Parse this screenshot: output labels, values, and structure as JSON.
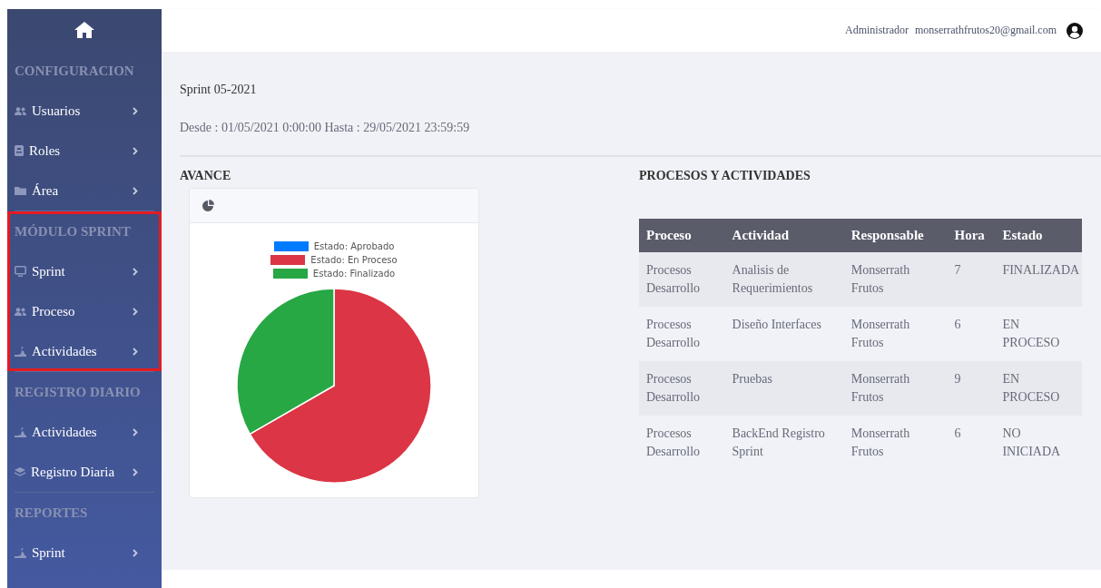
{
  "topbar": {
    "role": "Administrador",
    "email": "monserrathfrutos20@gmail.com"
  },
  "sidebar": {
    "sections": [
      {
        "title": "CONFIGURACION",
        "highlighted": false,
        "items": [
          {
            "label": "Usuarios"
          },
          {
            "label": "Roles"
          },
          {
            "label": "Área"
          }
        ]
      },
      {
        "title": "MÓDULO SPRINT",
        "highlighted": true,
        "items": [
          {
            "label": "Sprint"
          },
          {
            "label": "Proceso"
          },
          {
            "label": "Actividades"
          }
        ]
      },
      {
        "title": "REGISTRO DIARIO",
        "highlighted": false,
        "items": [
          {
            "label": "Actividades"
          },
          {
            "label": "Registro Diaria"
          }
        ]
      },
      {
        "title": "REPORTES",
        "highlighted": false,
        "items": [
          {
            "label": "Sprint"
          }
        ]
      }
    ]
  },
  "sprint": {
    "title": "Sprint 05-2021",
    "range": "Desde : 01/05/2021 0:00:00 Hasta : 29/05/2021 23:59:59"
  },
  "avance": {
    "title": "AVANCE",
    "chart_data": {
      "type": "pie",
      "categories": [
        "Estado: Aprobado",
        "Estado: En Proceso",
        "Estado: Finalizado"
      ],
      "values": [
        0,
        66.7,
        33.3
      ],
      "legend": "top",
      "colors": [
        "#007bff",
        "#dc3545",
        "#28a745"
      ]
    }
  },
  "procesos": {
    "title": "PROCESOS Y ACTIVIDADES",
    "columns": [
      "Proceso",
      "Actividad",
      "Responsable",
      "Hora",
      "Estado"
    ],
    "rows": [
      [
        "Procesos Desarrollo",
        "Analisis de Requerimientos",
        "Monserrath Frutos",
        "7",
        "FINALIZADA"
      ],
      [
        "Procesos Desarrollo",
        "Diseño Interfaces",
        "Monserrath Frutos",
        "6",
        "EN PROCESO"
      ],
      [
        "Procesos Desarrollo",
        "Pruebas",
        "Monserrath Frutos",
        "9",
        "EN PROCESO"
      ],
      [
        "Procesos Desarrollo",
        "BackEnd Registro Sprint",
        "Monserrath Frutos",
        "6",
        "NO INICIADA"
      ]
    ]
  }
}
